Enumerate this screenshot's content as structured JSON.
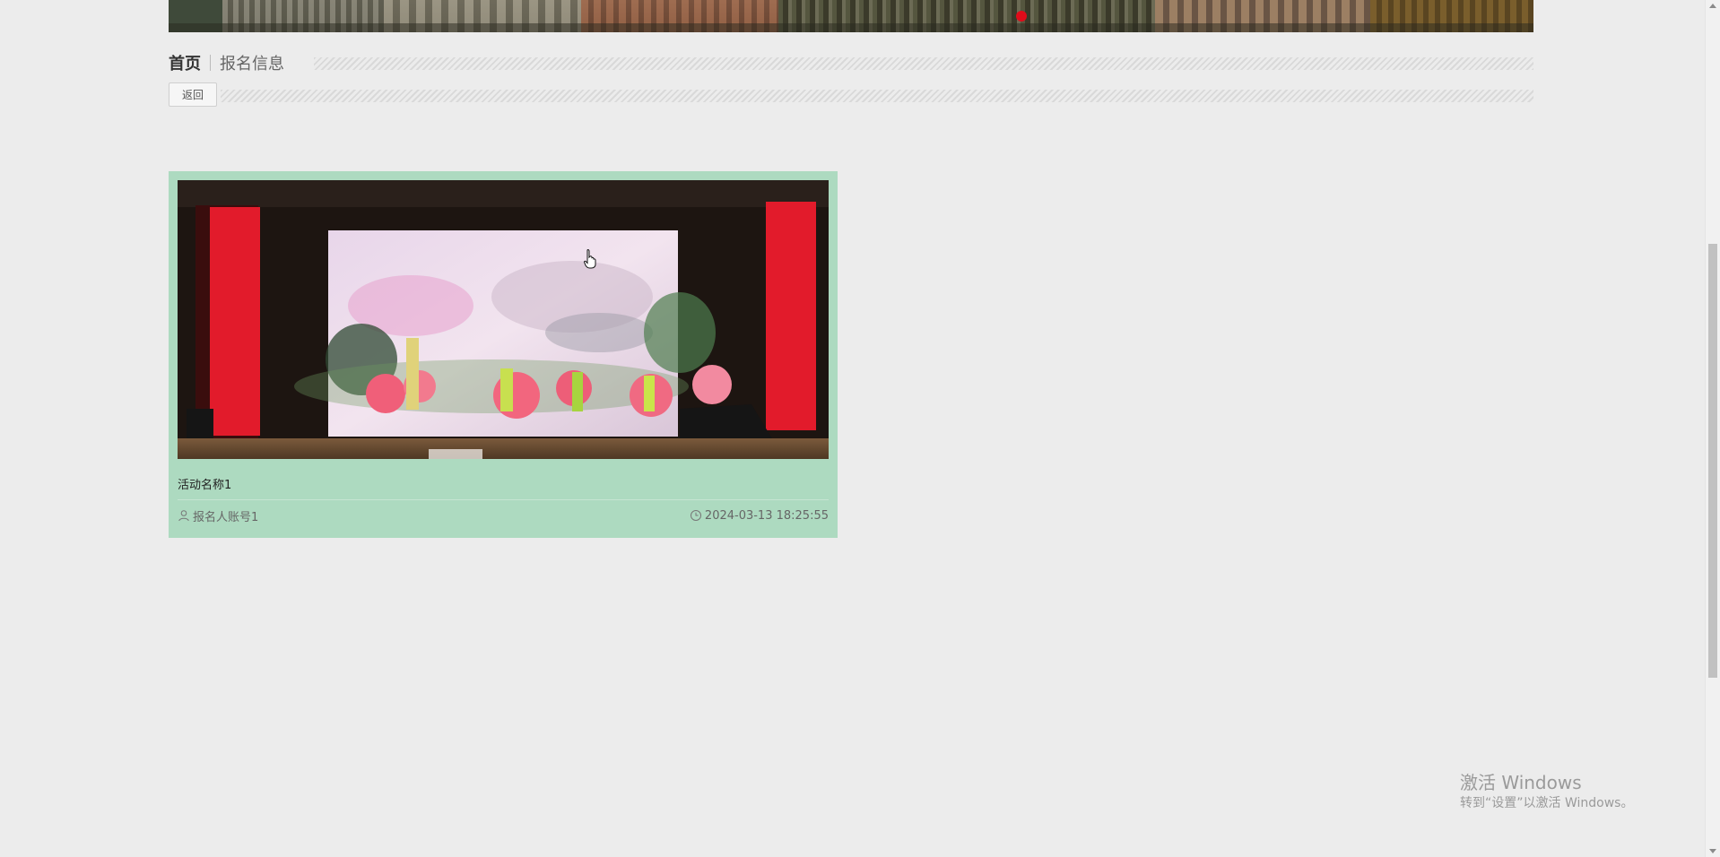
{
  "breadcrumb": {
    "home": "首页",
    "current": "报名信息"
  },
  "toolbar": {
    "back_label": "返回"
  },
  "records": [
    {
      "title": "活动名称1",
      "user": "报名人账号1",
      "time": "2024-03-13 18:25:55",
      "image": "stage-performance-photo"
    }
  ],
  "watermark": {
    "title": "激活 Windows",
    "subtitle": "转到“设置”以激活 Windows。"
  },
  "colors": {
    "card_background": "#addac0",
    "page_background": "#ececec",
    "banner_indicator": "#e00c1a"
  },
  "icons": {
    "user": "user-icon",
    "time": "clock-icon"
  }
}
